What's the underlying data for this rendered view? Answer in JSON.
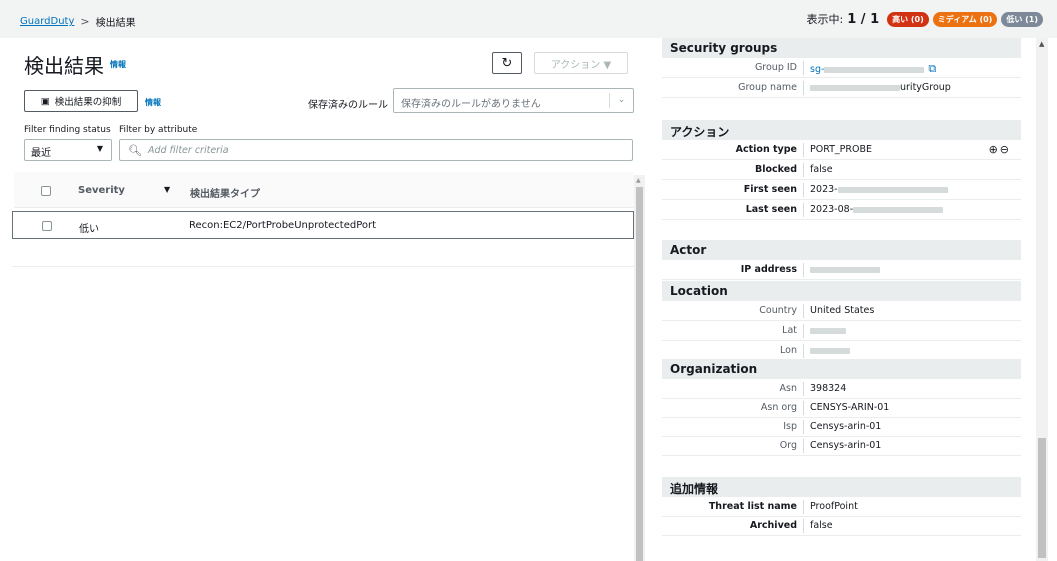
{
  "breadcrumb": {
    "root": "GuardDuty",
    "separator": ">",
    "current": "検出結果"
  },
  "counter": {
    "label": "表示中:",
    "value": "1 / 1",
    "high": "高い (0)",
    "medium": "ミディアム (0)",
    "low": "低い (1)"
  },
  "colors": {
    "high": "#d13212",
    "medium": "#ec7211",
    "low": "#7d8998",
    "link": "#0073bb"
  },
  "left": {
    "title": "検出結果",
    "info": "情報",
    "refresh_icon": "refresh-icon",
    "actions_label": "アクション ▼",
    "suppress_label": "検出結果の抑制",
    "suppress_info": "情報",
    "saved_rules_label": "保存済みのルール",
    "saved_rules_value": "保存済みのルールがありません",
    "filter_status_label": "Filter finding status",
    "filter_attr_label": "Filter by attribute",
    "status_value": "最近",
    "filter_placeholder": "Add filter criteria",
    "table": {
      "headers": {
        "severity": "Severity",
        "type": "検出結果タイプ"
      },
      "rows": [
        {
          "severity": "低い",
          "type": "Recon:EC2/PortProbeUnprotectedPort"
        }
      ]
    }
  },
  "right": {
    "security_groups": {
      "title": "Security groups",
      "group_id_key": "Group ID",
      "group_id_prefix": "sg-",
      "group_name_key": "Group name",
      "group_name_suffix": "urityGroup"
    },
    "action": {
      "title": "アクション",
      "rows": [
        {
          "k": "Action type",
          "v": "PORT_PROBE"
        },
        {
          "k": "Blocked",
          "v": "false"
        },
        {
          "k": "First seen",
          "v": "2023-"
        },
        {
          "k": "Last seen",
          "v": "2023-08-"
        }
      ]
    },
    "actor": {
      "title": "Actor",
      "ip_key": "IP address"
    },
    "location": {
      "title": "Location",
      "country_key": "Country",
      "country_value": "United States",
      "lat_key": "Lat",
      "lon_key": "Lon"
    },
    "organization": {
      "title": "Organization",
      "rows": [
        {
          "k": "Asn",
          "v": "398324"
        },
        {
          "k": "Asn org",
          "v": "CENSYS-ARIN-01"
        },
        {
          "k": "Isp",
          "v": "Censys-arin-01"
        },
        {
          "k": "Org",
          "v": "Censys-arin-01"
        }
      ]
    },
    "additional": {
      "title": "追加情報",
      "rows": [
        {
          "k": "Threat list name",
          "v": "ProofPoint"
        },
        {
          "k": "Archived",
          "v": "false"
        }
      ]
    }
  }
}
